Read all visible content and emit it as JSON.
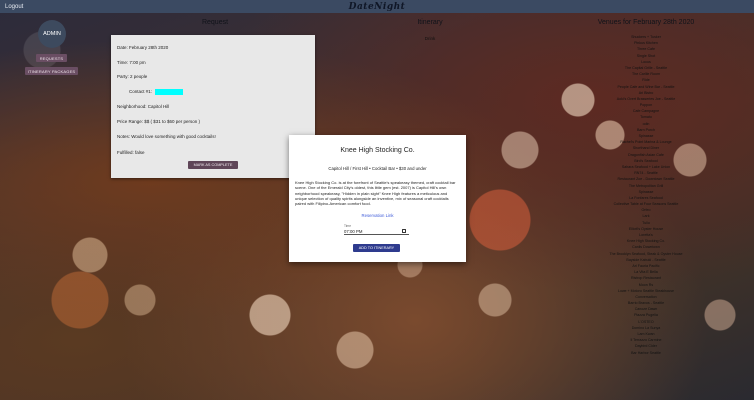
{
  "topbar": {
    "logout": "Logout",
    "brand": "DateNight"
  },
  "sidebar": {
    "avatar": "ADMIN",
    "requests": "REQUESTS",
    "itinerary": "ITINERARY PACKAGES"
  },
  "columns": {
    "request": "Request",
    "itinerary": "Itinerary",
    "venues": "Venues for February 28th 2020"
  },
  "request": {
    "date": "Date: February 28th 2020",
    "time": "Time: 7:00 pm",
    "party": "Party: 2 people",
    "contact": "Contact #1:",
    "neighborhood": "Neighborhood: Capitol Hill",
    "price": "Price Range: $$ ( $31 to $60 per person )",
    "notes": "Notes: Would love something with good cocktails!",
    "fulfilled": "Fulfilled: false",
    "complete_button": "MARK AS COMPLETE"
  },
  "itinerary": {
    "items": [
      "Drink"
    ]
  },
  "venues": [
    "Shuckers + Tusker",
    "Pinkus Kitchen",
    "Three Cafe",
    "Single Shot",
    "Locus",
    "The Capital Grille - Seattle",
    "The Carlile Room",
    "Ride",
    "People Cafe and Wine Bar - Seattle",
    "Ari Bistro",
    "Aoki's Overt Brasseries Joe - Seattle",
    "Poppon",
    "Cafe Campagne",
    "Tomato",
    "odin",
    "Barn Porch",
    "Spinasse",
    "Rachel's Point Marina & Lounge",
    "Shorthand Diner",
    "Dragonfish Asian Cafe",
    "Bird's Seafood",
    "Sahara Seafood + Lake Union",
    "RN74 - Seattle",
    "Restaurant Zoe - Downtown Seattle",
    "The Metropolitan Grill",
    "Spinasse",
    "La Fonfares Seafood",
    "Collective Table at Four Seasons Seattle",
    "Orfeo",
    "Lark",
    "Tulio",
    "Elliott's Oyster House",
    "Loretta's",
    "Knee High Stocking Co.",
    "Canlis Downtown",
    "The Brooklyn Seafood, Steak & Oyster House",
    "Bayside Kabuki - Seattle",
    "Ari Fauria Pacific",
    "La Vita E Bella",
    "Ristrop Restaurant",
    "Moon Rs",
    "Lowe + Motoro Seattle Steakhouse",
    "Conversation",
    "Barrio Bravos - Seattle",
    "Canoze Dawn",
    "Piazza Pugelia",
    "L'OSTEO",
    "Domino La Sunya",
    "Lam Kwan",
    "Il Terrazzo Carmine",
    "Daybird Cider",
    "Bar Harbor Seattle"
  ],
  "modal": {
    "title": "Knee High Stocking Co.",
    "subtitle": "Capitol Hill / First Hill • Cocktail Bar • $30 and under",
    "description": "Knee High Stocking Co. is at the forefront of Seattle's speakeasy themed, craft cocktail bar scene. One of the Emerald City's oldest, this little gem (est. 2007) is Capitol Hill's own neighborhood speakeasy, \"Hidden in plain sight\" Knee High features a meticulous and unique selection of quality spirits alongside an inventive, mix of seasonal craft cocktails paired with Filipino-American comfort food.",
    "reservation_link": "Reservation Link",
    "time_label": "Time",
    "time_value": "07:00 PM",
    "add_button": "ADD TO ITINERARY"
  },
  "colors": {
    "topbar": "#3b4a62",
    "sidebar_button": "#6a4e63",
    "contact_highlight": "#00ffff",
    "primary_button": "#2e3b8e"
  },
  "icons": {
    "time_picker": "clock-icon"
  }
}
